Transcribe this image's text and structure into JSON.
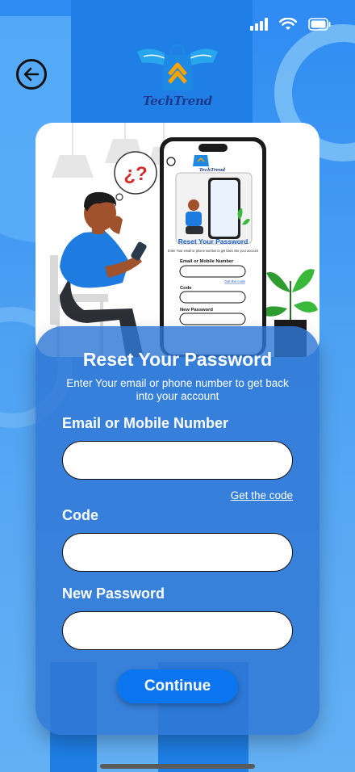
{
  "status_bar": {
    "icons": [
      "signal-icon",
      "wifi-icon",
      "battery-icon"
    ]
  },
  "header": {
    "back_icon": "arrow-left-icon",
    "logo_text": "TechTrend"
  },
  "illustration": {
    "bubble_text": "¿?",
    "phone": {
      "logo_text": "TechTrend",
      "title": "Reset Your Password",
      "subtitle": "Enter Your email or phone number to get back into your account",
      "field1_label": "Email or Mobile Number",
      "link_label": "Get the code",
      "field2_label": "Code",
      "field3_label": "New Password"
    }
  },
  "form": {
    "title": "Reset Your Password",
    "subtitle": "Enter Your email or phone number to get back into your account",
    "email_label": "Email or Mobile Number",
    "email_value": "",
    "get_code_label": "Get the code",
    "code_label": "Code",
    "code_value": "",
    "password_label": "New Password",
    "password_value": "",
    "continue_label": "Continue"
  },
  "colors": {
    "background": "#3d93f0",
    "card": "#3077d6",
    "button": "#0a75ee",
    "text": "#ffffff"
  }
}
